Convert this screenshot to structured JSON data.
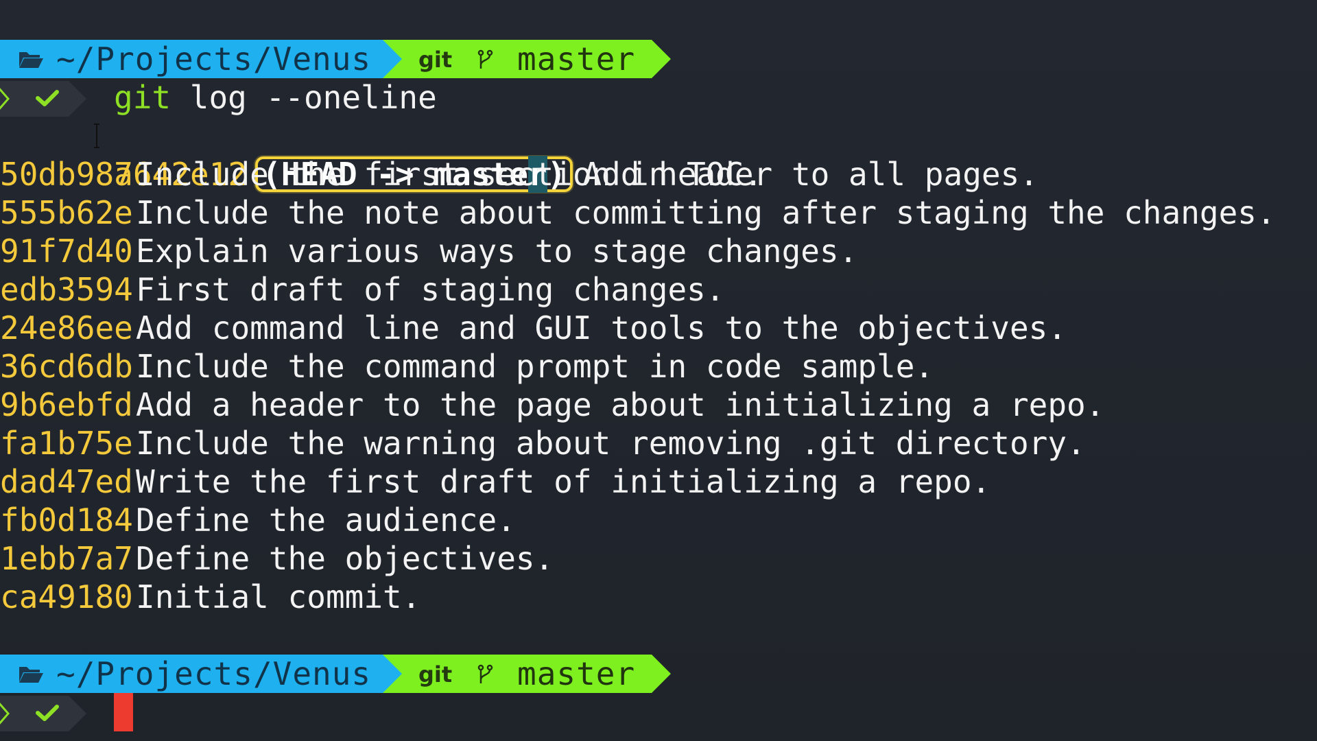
{
  "prompt": {
    "path": "~/Projects/Venus",
    "git_label": "git",
    "branch": "master",
    "folder_icon": "folder-open-icon",
    "branch_icon": "git-branch-icon",
    "status_icon": "check-icon",
    "chevron_icon": "chevron-right-icon"
  },
  "command": {
    "keyword": "git",
    "args": " log --oneline"
  },
  "head_ref": {
    "open": "(",
    "label": "HEAD -> maste",
    "selected": "r",
    "close": ")"
  },
  "log": [
    {
      "hash": "a642e12",
      "message": "Add header to all pages."
    },
    {
      "hash": "50db987",
      "message": "Include the first section in TOC."
    },
    {
      "hash": "555b62e",
      "message": "Include the note about committing after staging the changes."
    },
    {
      "hash": "91f7d40",
      "message": "Explain various ways to stage changes."
    },
    {
      "hash": "edb3594",
      "message": "First draft of staging changes."
    },
    {
      "hash": "24e86ee",
      "message": "Add command line and GUI tools to the objectives."
    },
    {
      "hash": "36cd6db",
      "message": "Include the command prompt in code sample."
    },
    {
      "hash": "9b6ebfd",
      "message": "Add a header to the page about initializing a repo."
    },
    {
      "hash": "fa1b75e",
      "message": "Include the warning about removing .git directory."
    },
    {
      "hash": "dad47ed",
      "message": "Write the first draft of initializing a repo."
    },
    {
      "hash": "fb0d184",
      "message": "Define the audience."
    },
    {
      "hash": "1ebb7a7",
      "message": "Define the objectives."
    },
    {
      "hash": "ca49180",
      "message": "Initial commit."
    }
  ],
  "colors": {
    "path_segment": "#1fb0ef",
    "git_segment": "#7ff01f",
    "hash": "#f4c93b",
    "cursor": "#ee3b2f",
    "head_highlight": "#f4d43a"
  }
}
